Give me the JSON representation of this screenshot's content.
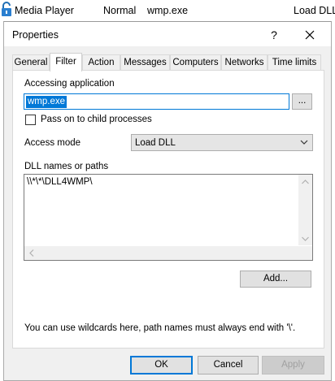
{
  "background_row": {
    "name": "Media Player",
    "col2": "Normal",
    "col3": "wmp.exe",
    "col4": "Load DLL"
  },
  "dialog": {
    "title": "Properties",
    "help_glyph": "?",
    "tabs": [
      {
        "label": "General"
      },
      {
        "label": "Filter"
      },
      {
        "label": "Action"
      },
      {
        "label": "Messages"
      },
      {
        "label": "Computers"
      },
      {
        "label": "Networks"
      },
      {
        "label": "Time limits"
      }
    ],
    "active_tab": "Filter",
    "filter": {
      "accessing_application_label": "Accessing application",
      "accessing_application_value": "wmp.exe",
      "browse_button": "...",
      "pass_on_label": "Pass on to child processes",
      "pass_on_checked": false,
      "access_mode_label": "Access mode",
      "access_mode_value": "Load DLL",
      "dll_label": "DLL names or paths",
      "dll_entries": [
        "\\\\*\\*\\DLL4WMP\\"
      ],
      "add_button": "Add...",
      "hint": "You can use wildcards here, path names must always end with '\\'."
    },
    "buttons": {
      "ok": "OK",
      "cancel": "Cancel",
      "apply": "Apply"
    }
  }
}
